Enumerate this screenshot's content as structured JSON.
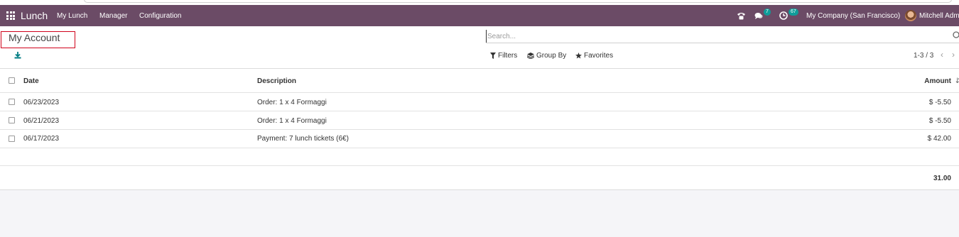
{
  "app": {
    "name": "Lunch"
  },
  "navbar": {
    "menus": [
      "My Lunch",
      "Manager",
      "Configuration"
    ],
    "chat_badge": "7",
    "activity_badge": "67",
    "company": "My Company (San Francisco)",
    "user": "Mitchell Adm"
  },
  "control_panel": {
    "title": "My Account",
    "search_placeholder": "Search...",
    "filters_label": "Filters",
    "group_by_label": "Group By",
    "favorites_label": "Favorites",
    "pager": "1-3 / 3"
  },
  "table": {
    "headers": {
      "date": "Date",
      "description": "Description",
      "amount": "Amount"
    },
    "rows": [
      {
        "date": "06/23/2023",
        "description": "Order: 1 x 4 Formaggi",
        "amount": "$ -5.50"
      },
      {
        "date": "06/21/2023",
        "description": "Order: 1 x 4 Formaggi",
        "amount": "$ -5.50"
      },
      {
        "date": "06/17/2023",
        "description": "Payment: 7 lunch tickets (6€)",
        "amount": "$ 42.00"
      }
    ],
    "total": "31.00"
  },
  "colors": {
    "navbar": "#6b4b66",
    "accent": "#017e84",
    "badge": "#0f9d9a"
  }
}
